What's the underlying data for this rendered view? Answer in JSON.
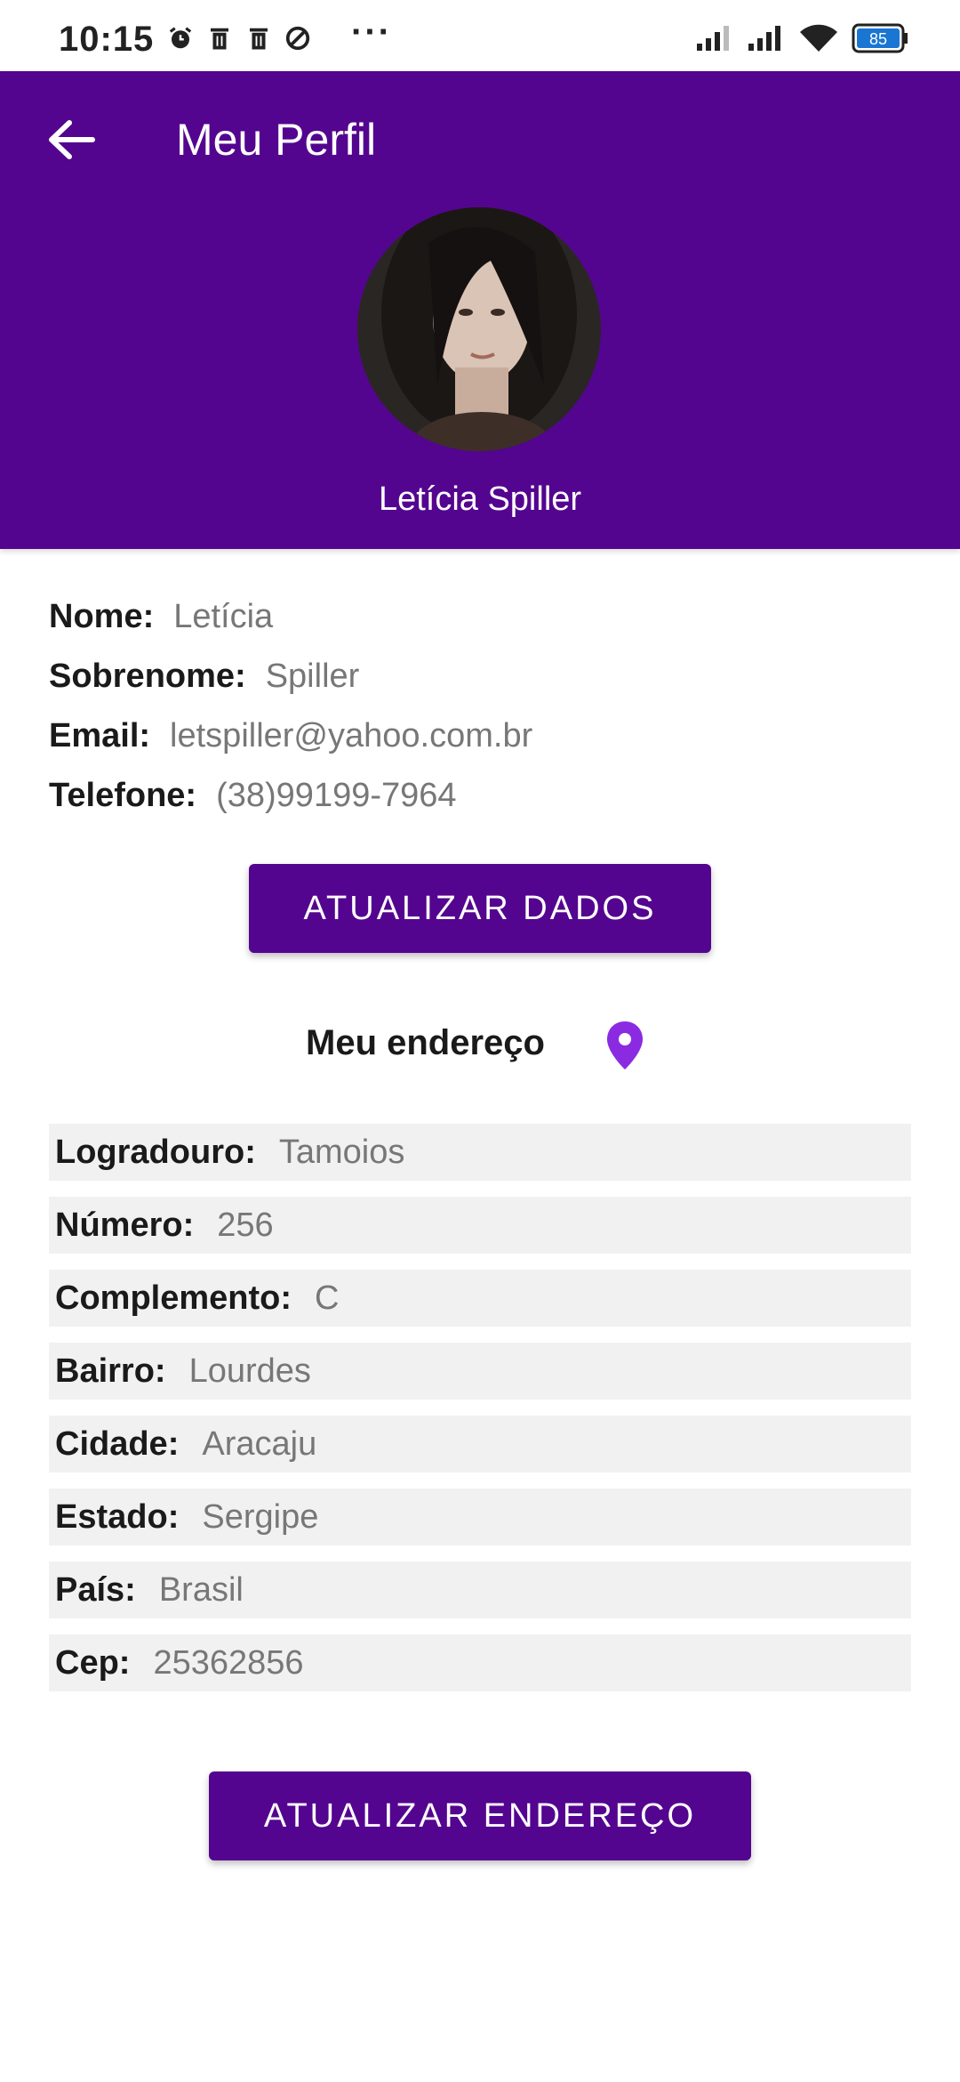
{
  "status_bar": {
    "time": "10:15",
    "more": "···",
    "battery": "85"
  },
  "header": {
    "title": "Meu Perfil",
    "profile_name": "Letícia Spiller"
  },
  "personal": [
    {
      "label": "Nome:",
      "value": "Letícia"
    },
    {
      "label": "Sobrenome:",
      "value": "Spiller"
    },
    {
      "label": "Email:",
      "value": "letspiller@yahoo.com.br"
    },
    {
      "label": "Telefone:",
      "value": "(38)99199-7964"
    }
  ],
  "buttons": {
    "update_data": "ATUALIZAR DADOS",
    "update_address": "ATUALIZAR ENDEREÇO"
  },
  "address": {
    "heading": "Meu endereço",
    "fields": [
      {
        "label": "Logradouro:",
        "value": "Tamoios"
      },
      {
        "label": "Número:",
        "value": "256"
      },
      {
        "label": "Complemento:",
        "value": "C"
      },
      {
        "label": "Bairro:",
        "value": "Lourdes"
      },
      {
        "label": "Cidade:",
        "value": "Aracaju"
      },
      {
        "label": "Estado:",
        "value": "Sergipe"
      },
      {
        "label": "País:",
        "value": "Brasil"
      },
      {
        "label": "Cep:",
        "value": "25362856"
      }
    ]
  },
  "colors": {
    "primary": "#54058f",
    "pin": "#8a2be2",
    "field_bg": "#f1f1f1"
  },
  "icons": [
    "back-arrow-icon",
    "location-pin-icon",
    "alarm-icon",
    "trash-icon",
    "signal-icon",
    "wifi-icon",
    "battery-icon"
  ]
}
